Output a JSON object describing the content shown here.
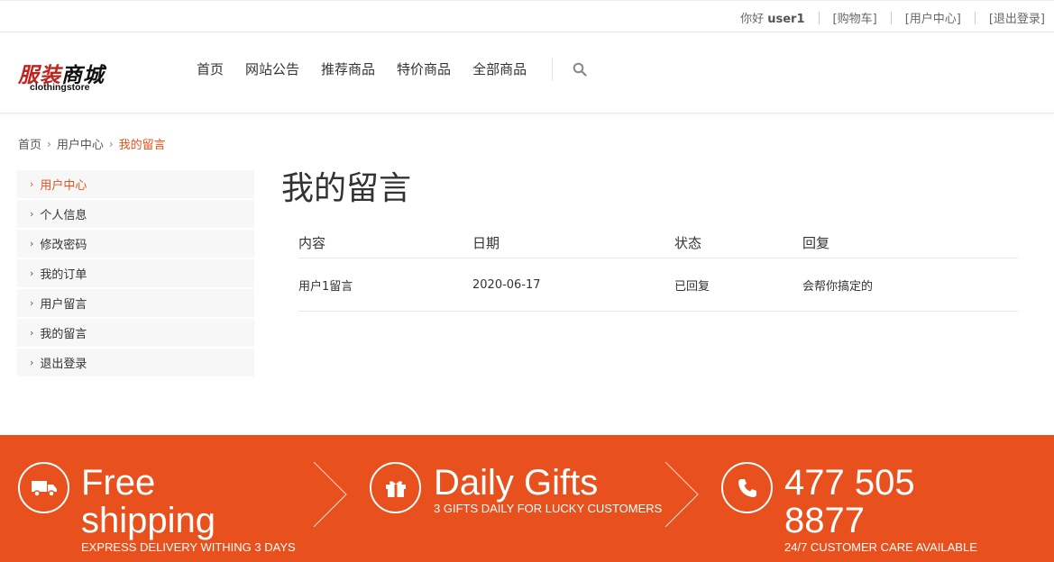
{
  "topbar": {
    "greeting": "你好",
    "username": "user1",
    "cart": "[购物车]",
    "user_center": "[用户中心]",
    "logout": "[退出登录]"
  },
  "logo": {
    "cn_red": "服装",
    "cn_black": "商城",
    "en": "clothingstore"
  },
  "nav": [
    "首页",
    "网站公告",
    "推荐商品",
    "特价商品",
    "全部商品"
  ],
  "breadcrumb": {
    "home": "首页",
    "parent": "用户中心",
    "current": "我的留言"
  },
  "sidebar": {
    "items": [
      {
        "label": "用户中心"
      },
      {
        "label": "个人信息"
      },
      {
        "label": "修改密码"
      },
      {
        "label": "我的订单"
      },
      {
        "label": "用户留言"
      },
      {
        "label": "我的留言"
      },
      {
        "label": "退出登录"
      }
    ],
    "active_index": 0
  },
  "main": {
    "title": "我的留言",
    "columns": [
      "内容",
      "日期",
      "状态",
      "回复"
    ],
    "rows": [
      [
        "用户1留言",
        "2020-06-17",
        "已回复",
        "会帮你搞定的"
      ]
    ]
  },
  "footer": {
    "accent": "#e8501e",
    "features": [
      {
        "icon": "truck-icon",
        "title_line1": "Free",
        "title_line2": "shipping",
        "subtitle": "EXPRESS DELIVERY WITHING 3 DAYS"
      },
      {
        "icon": "gift-icon",
        "title_line1": "Daily Gifts",
        "title_line2": "",
        "subtitle": "3 GIFTS DAILY FOR LUCKY CUSTOMERS"
      },
      {
        "icon": "phone-icon",
        "title_line1": "477 505",
        "title_line2": "8877",
        "subtitle": "24/7 CUSTOMER CARE AVAILABLE"
      }
    ]
  }
}
